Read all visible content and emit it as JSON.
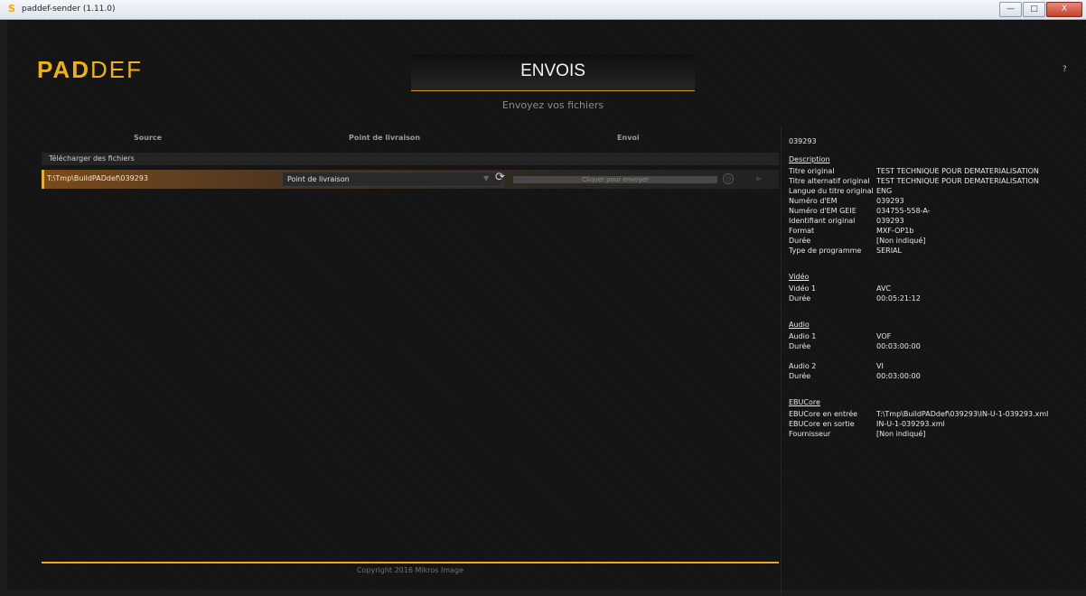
{
  "window": {
    "icon": "S",
    "title": "paddef-sender (1.11.0)",
    "controls": [
      "—",
      "□",
      "X"
    ]
  },
  "app": {
    "logo_bold": "PAD",
    "logo_light": "DEF",
    "page_title": "ENVOIS",
    "page_subtitle": "Envoyez vos fichiers",
    "help_label": "?",
    "footer": "Copyright 2016 Mikros Image"
  },
  "columns": {
    "source": "Source",
    "delivery": "Point de livraison",
    "send": "Envoi"
  },
  "section": {
    "label": "Télécharger des fichiers"
  },
  "file_row": {
    "source": "T:\\Tmp\\BuildPADdef\\039293",
    "delivery_value": "Point de livraison",
    "send_label": "Cliquer pour envoyer"
  },
  "details": {
    "id": "039293",
    "description_heading": "Description",
    "description": [
      {
        "label": "Titre original",
        "value": "TEST TECHNIQUE POUR DEMATERIALISATION"
      },
      {
        "label": "Titre alternatif original",
        "value": "TEST TECHNIQUE POUR DEMATERIALISATION"
      },
      {
        "label": "Langue du titre original",
        "value": "ENG"
      },
      {
        "label": "Numéro d'EM",
        "value": "039293"
      },
      {
        "label": "Numéro d'EM GEIE",
        "value": "034755-558-A-"
      },
      {
        "label": "Identifiant original",
        "value": "039293"
      },
      {
        "label": "Format",
        "value": "MXF-OP1b"
      },
      {
        "label": "Durée",
        "value": "[Non indiqué]"
      },
      {
        "label": "Type de programme",
        "value": "SERIAL"
      }
    ],
    "video_heading": "Vidéo",
    "video": [
      {
        "label": "Vidéo 1",
        "value": "AVC"
      },
      {
        "label": "Durée",
        "value": "00:05:21:12"
      }
    ],
    "audio_heading": "Audio",
    "audio1": [
      {
        "label": "Audio 1",
        "value": "VOF"
      },
      {
        "label": "Durée",
        "value": "00:03:00:00"
      }
    ],
    "audio2": [
      {
        "label": "Audio 2",
        "value": "VI"
      },
      {
        "label": "Durée",
        "value": "00:03:00:00"
      }
    ],
    "ebucore_heading": "EBUCore",
    "ebucore": [
      {
        "label": "EBUCore en entrée",
        "value": "T:\\Tmp\\BuildPADdef\\039293\\IN-U-1-039293.xml"
      },
      {
        "label": "EBUCore en sortie",
        "value": "IN-U-1-039293.xml"
      },
      {
        "label": "Fournisseur",
        "value": "[Non indiqué]"
      }
    ]
  },
  "colors": {
    "accent": "#f2b10e",
    "background": "#141414",
    "row_highlight": "#7a4a1c"
  }
}
